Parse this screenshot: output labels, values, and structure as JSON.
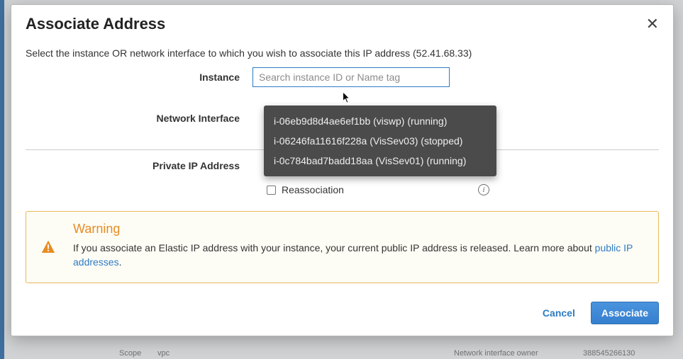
{
  "header": {
    "title": "Associate Address"
  },
  "description": "Select the instance OR network interface to which you wish to associate this IP address (52.41.68.33)",
  "labels": {
    "instance": "Instance",
    "network_interface": "Network Interface",
    "private_ip": "Private IP Address",
    "reassociation": "Reassociation"
  },
  "search": {
    "placeholder": "Search instance ID or Name tag",
    "value": ""
  },
  "dropdown": {
    "items": [
      "i-06eb9d8d4ae6ef1bb (viswp) (running)",
      "i-06246fa11616f228a (VisSev03) (stopped)",
      "i-0c784bad7badd18aa (VisSev01) (running)"
    ]
  },
  "warning": {
    "title": "Warning",
    "text": "If you associate an Elastic IP address with your instance, your current public IP address is released. Learn more about ",
    "link_text": "public IP addresses",
    "after_link": "."
  },
  "footer": {
    "cancel": "Cancel",
    "submit": "Associate"
  },
  "background_bottom": {
    "scope_label": "Scope",
    "scope_value": "vpc",
    "owner_label": "Network interface owner",
    "owner_value": "388545266130"
  }
}
